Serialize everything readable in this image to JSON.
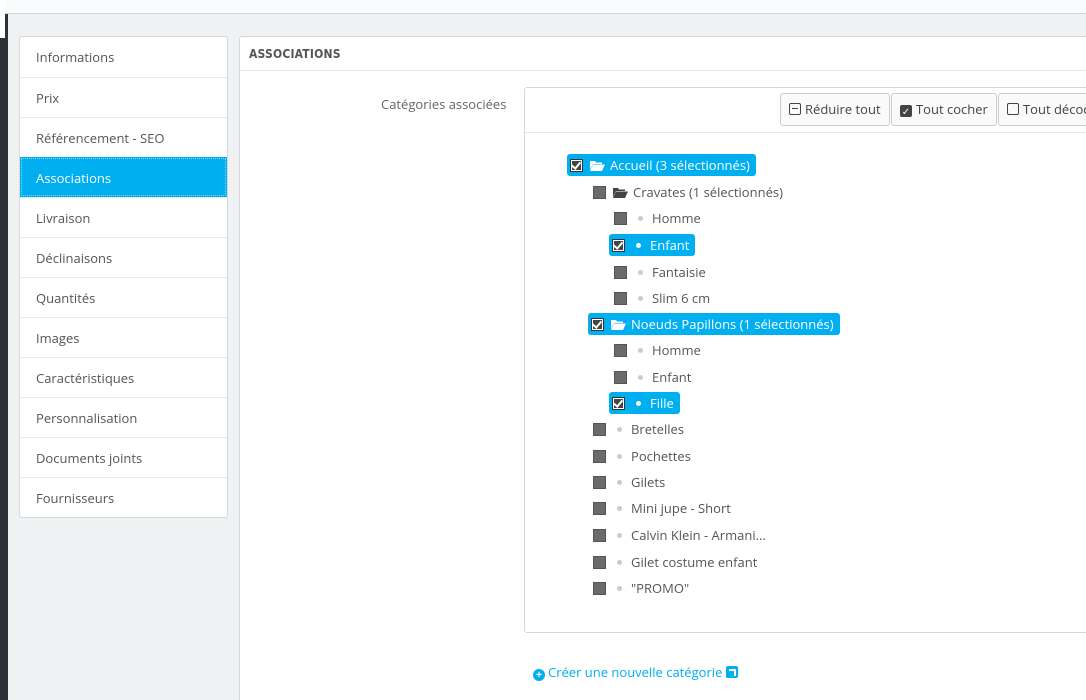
{
  "tabs": [
    {
      "label": "Informations",
      "active": false
    },
    {
      "label": "Prix",
      "active": false
    },
    {
      "label": "Référencement - SEO",
      "active": false
    },
    {
      "label": "Associations",
      "active": true
    },
    {
      "label": "Livraison",
      "active": false
    },
    {
      "label": "Déclinaisons",
      "active": false
    },
    {
      "label": "Quantités",
      "active": false
    },
    {
      "label": "Images",
      "active": false
    },
    {
      "label": "Caractéristiques",
      "active": false
    },
    {
      "label": "Personnalisation",
      "active": false
    },
    {
      "label": "Documents joints",
      "active": false
    },
    {
      "label": "Fournisseurs",
      "active": false
    }
  ],
  "panel": {
    "title": "ASSOCIATIONS",
    "categories_label": "Catégories associées",
    "toolbar": {
      "collapse_label": "Réduire tout",
      "check_all_label": "Tout cocher",
      "uncheck_all_label": "Tout décocher"
    },
    "tree": [
      {
        "label": "Accueil (3 sélectionnés)",
        "type": "folder",
        "checked": true,
        "selected": true
      },
      {
        "label": "Cravates (1 sélectionnés)",
        "type": "folder",
        "checked": false,
        "selected": false
      },
      {
        "label": "Homme",
        "type": "leaf",
        "checked": false,
        "selected": false
      },
      {
        "label": "Enfant",
        "type": "leaf",
        "checked": true,
        "selected": true
      },
      {
        "label": "Fantaisie",
        "type": "leaf",
        "checked": false,
        "selected": false
      },
      {
        "label": "Slim 6 cm",
        "type": "leaf",
        "checked": false,
        "selected": false
      },
      {
        "label": "Noeuds Papillons (1 sélectionnés)",
        "type": "folder",
        "checked": true,
        "selected": true
      },
      {
        "label": "Homme",
        "type": "leaf",
        "checked": false,
        "selected": false
      },
      {
        "label": "Enfant",
        "type": "leaf",
        "checked": false,
        "selected": false
      },
      {
        "label": "Fille",
        "type": "leaf",
        "checked": true,
        "selected": true
      },
      {
        "label": "Bretelles",
        "type": "leaf",
        "checked": false,
        "selected": false
      },
      {
        "label": "Pochettes",
        "type": "leaf",
        "checked": false,
        "selected": false
      },
      {
        "label": "Gilets",
        "type": "leaf",
        "checked": false,
        "selected": false
      },
      {
        "label": "Mini jupe - Short",
        "type": "leaf",
        "checked": false,
        "selected": false
      },
      {
        "label": "Calvin Klein - Armani...",
        "type": "leaf",
        "checked": false,
        "selected": false
      },
      {
        "label": "Gilet costume enfant",
        "type": "leaf",
        "checked": false,
        "selected": false
      },
      {
        "label": "\"PROMO\"",
        "type": "leaf",
        "checked": false,
        "selected": false
      }
    ],
    "create_link": "Créer une nouvelle catégorie"
  },
  "colors": {
    "accent": "#00aff0",
    "border": "#d3d8db",
    "background": "#eff1f2"
  },
  "icons": {
    "collapse": "minus-square-icon",
    "check_all": "check-square-icon",
    "uncheck_all": "square-icon",
    "folder": "folder-open-icon",
    "create": "plus-circle-icon",
    "external": "external-link-icon"
  }
}
